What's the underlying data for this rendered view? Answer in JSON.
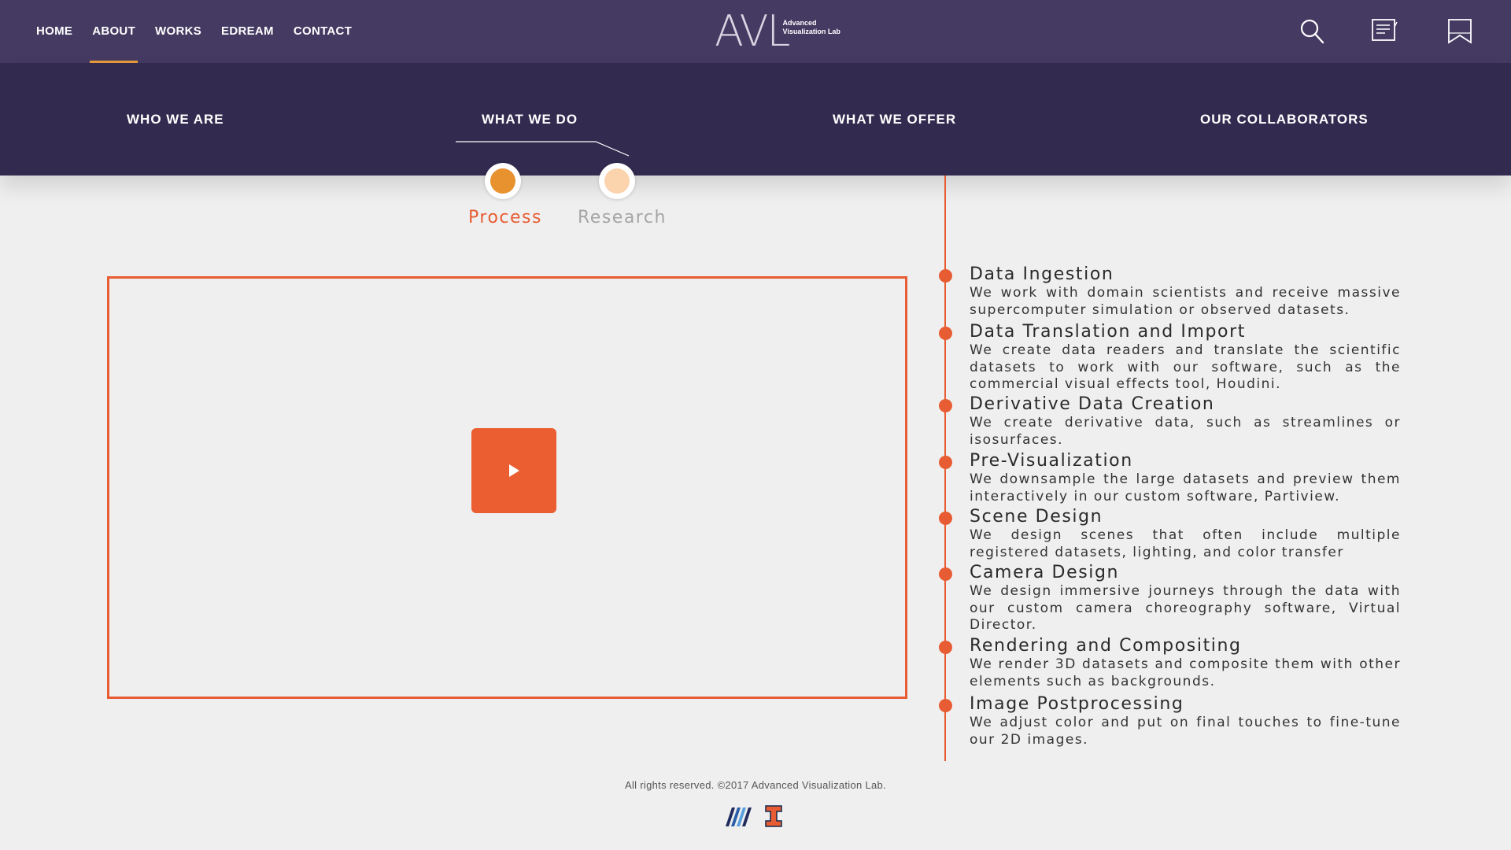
{
  "nav": {
    "items": [
      {
        "label": "HOME"
      },
      {
        "label": "ABOUT"
      },
      {
        "label": "WORKS"
      },
      {
        "label": "EDREAM"
      },
      {
        "label": "CONTACT"
      }
    ],
    "active": "ABOUT"
  },
  "logo": {
    "mark": "AVL",
    "line1": "Advanced",
    "line2": "Visualization Lab"
  },
  "header_icons": [
    "search-icon",
    "notes-icon",
    "bookmark-icon"
  ],
  "subnav": {
    "tabs": [
      {
        "label": "WHO WE ARE"
      },
      {
        "label": "WHAT WE DO"
      },
      {
        "label": "WHAT WE OFFER"
      },
      {
        "label": "OUR COLLABORATORS"
      }
    ],
    "active": "WHAT WE DO"
  },
  "toggles": {
    "process": {
      "label": "Process",
      "color": "#e8912f",
      "active": true
    },
    "research": {
      "label": "Research",
      "color": "#fbd3ad",
      "active": false
    }
  },
  "video": {
    "play_icon": "play-icon"
  },
  "steps": [
    {
      "title": "Data Ingestion",
      "desc": "We work with domain scientists and receive massive supercomputer simulation or observed datasets."
    },
    {
      "title": "Data Translation and Import",
      "desc": "We create data readers and translate the scientific datasets to work with our software, such as the commercial visual effects tool, Houdini."
    },
    {
      "title": "Derivative Data Creation",
      "desc": "We create derivative data, such as streamlines or isosurfaces."
    },
    {
      "title": "Pre-Visualization",
      "desc": "We downsample the large datasets and preview them interactively in our custom software, Partiview."
    },
    {
      "title": "Scene Design",
      "desc": "We design scenes that often include multiple registered datasets, lighting, and color transfer"
    },
    {
      "title": "Camera Design",
      "desc": "We design immersive journeys through the data with our custom camera choreography software, Virtual Director."
    },
    {
      "title": "Rendering and Compositing",
      "desc": "We render 3D datasets and composite them with other elements such as backgrounds."
    },
    {
      "title": "Image Postprocessing",
      "desc": "We adjust color and put on final touches to fine-tune our 2D images."
    }
  ],
  "footer": {
    "text": "All rights reserved. ©2017 Advanced Visualization Lab.",
    "logos": [
      "ncsa-logo",
      "illinois-logo"
    ]
  },
  "colors": {
    "topbar": "#443a62",
    "subbar": "#332b4f",
    "accent": "#e85c33",
    "nav_underline": "#e89a3c"
  }
}
